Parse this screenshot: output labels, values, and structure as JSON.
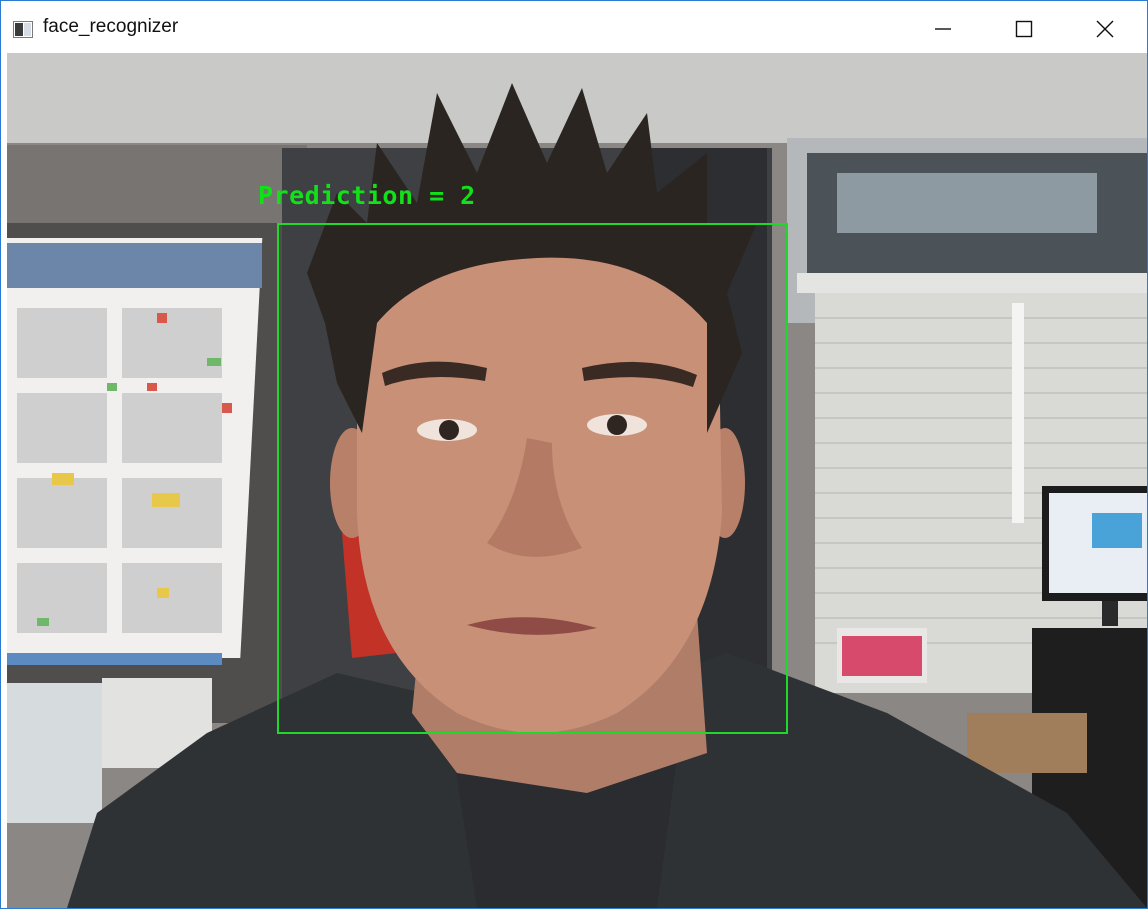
{
  "window": {
    "title": "face_recognizer",
    "controls": {
      "minimize": "minimize-icon",
      "maximize": "maximize-icon",
      "close": "close-icon"
    }
  },
  "overlay": {
    "prediction_text": "Prediction = 2",
    "box_color": "#21d82a",
    "text_color": "#12e019"
  },
  "colors": {
    "titlebar": "#ffffff",
    "window_border": "#2b7bd3"
  }
}
